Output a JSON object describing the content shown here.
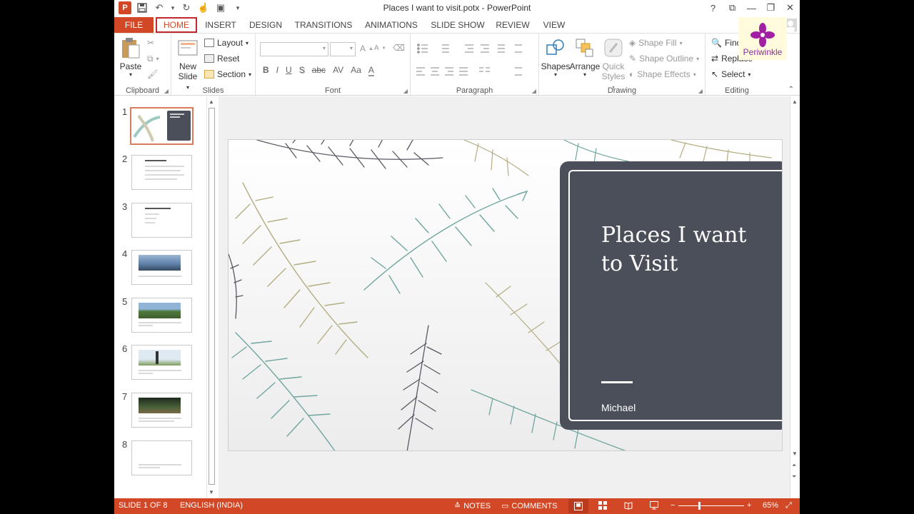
{
  "window": {
    "title": "Places I want to visit.potx - PowerPoint",
    "help": "?",
    "ribbon_display": "⧉",
    "minimize": "—",
    "restore": "❐",
    "close": "✕"
  },
  "qat": {
    "app_icon": "P",
    "save": "💾",
    "undo": "↶",
    "undo_more": "▾",
    "redo": "↻",
    "touch": "☝",
    "present": "▣",
    "customize": "▾"
  },
  "tabs": [
    "FILE",
    "HOME",
    "INSERT",
    "DESIGN",
    "TRANSITIONS",
    "ANIMATIONS",
    "SLIDE SHOW",
    "REVIEW",
    "VIEW"
  ],
  "ribbon": {
    "clipboard": {
      "paste": "Paste",
      "label": "Clipboard"
    },
    "slides": {
      "new_slide_line1": "New",
      "new_slide_line2": "Slide",
      "layout": "Layout",
      "reset": "Reset",
      "section": "Section",
      "label": "Slides"
    },
    "font": {
      "label": "Font",
      "bold": "B",
      "italic": "I",
      "underline": "U",
      "shadow": "S",
      "strike": "abc",
      "spacing": "AV",
      "case": "Aa",
      "color": "A",
      "grow": "A",
      "shrink": "A"
    },
    "paragraph": {
      "label": "Paragraph"
    },
    "drawing": {
      "shapes": "Shapes",
      "arrange": "Arrange",
      "quick_line1": "Quick",
      "quick_line2": "Styles",
      "fill": "Shape Fill",
      "outline": "Shape Outline",
      "effects": "Shape Effects",
      "label": "Drawing"
    },
    "editing": {
      "find": "Find",
      "replace": "Replace",
      "select": "Select",
      "label": "Editing"
    }
  },
  "thumbnails": [
    {
      "num": "1",
      "title": "Places I want to Visit"
    },
    {
      "num": "2",
      "title": "Ordered process"
    },
    {
      "num": "3",
      "title": "Places I want to visit"
    },
    {
      "num": "4",
      "title": ""
    },
    {
      "num": "5",
      "title": ""
    },
    {
      "num": "6",
      "title": ""
    },
    {
      "num": "7",
      "title": ""
    },
    {
      "num": "8",
      "title": ""
    }
  ],
  "slide": {
    "title": "Places I want to Visit",
    "subtitle": "Michael"
  },
  "status": {
    "slide": "SLIDE 1 OF 8",
    "language": "ENGLISH (INDIA)",
    "notes": "NOTES",
    "comments": "COMMENTS",
    "zoom_out": "−",
    "zoom_in": "+",
    "zoom": "65%",
    "fit": "⤢"
  },
  "watermark": {
    "text": "Periwinkle"
  },
  "colors": {
    "accent": "#d24726",
    "panel": "#4b4f59",
    "feather_teal": "#6fa69f",
    "feather_olive": "#b4ad82",
    "feather_dark": "#5a5763"
  }
}
